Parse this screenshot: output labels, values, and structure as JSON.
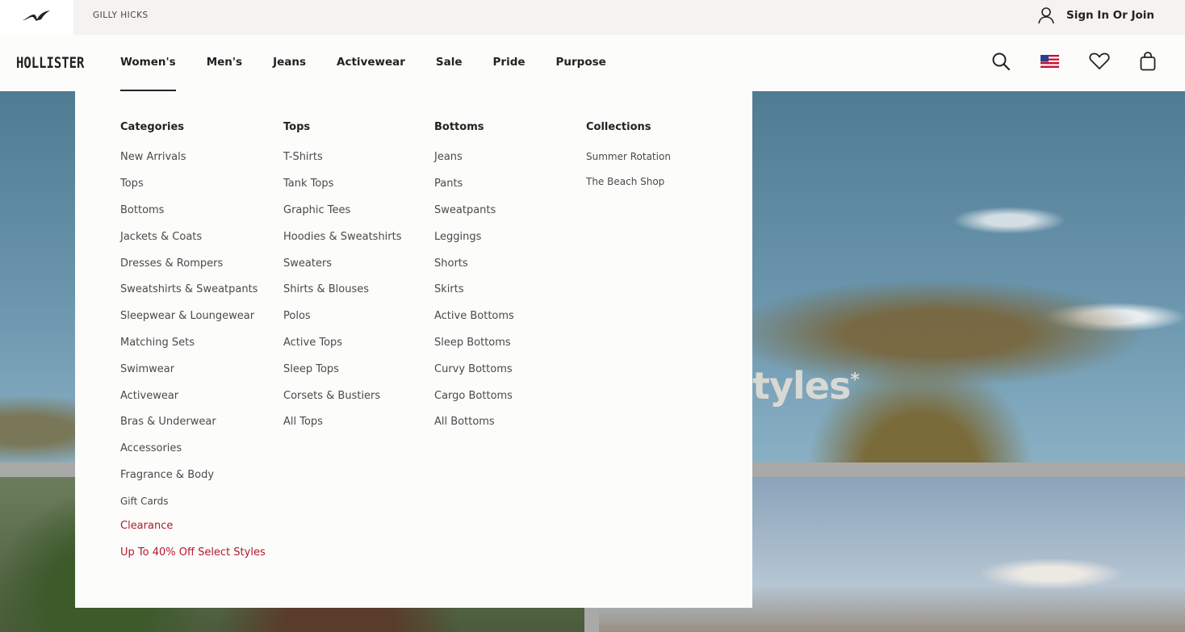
{
  "topbar": {
    "gilly_hicks": "GILLY HICKS",
    "sign_in": "Sign In Or Join"
  },
  "nav": {
    "logo": "HOLLISTER",
    "items": [
      "Women's",
      "Men's",
      "Jeans",
      "Activewear",
      "Sale",
      "Pride",
      "Purpose"
    ],
    "active": "Women's"
  },
  "hero": {
    "text": "tyles",
    "asterisk": "*"
  },
  "menu": {
    "categories": {
      "title": "Categories",
      "links": [
        "New Arrivals",
        "Tops",
        "Bottoms",
        "Jackets & Coats",
        "Dresses & Rompers",
        "Sweatshirts & Sweatpants",
        "Sleepwear & Loungewear",
        "Matching Sets",
        "Swimwear",
        "Activewear",
        "Bras & Underwear",
        "Accessories",
        "Fragrance & Body",
        "Gift Cards",
        "Clearance",
        "Up To 40% Off Select Styles"
      ]
    },
    "tops": {
      "title": "Tops",
      "links": [
        "T-Shirts",
        "Tank Tops",
        "Graphic Tees",
        "Hoodies & Sweatshirts",
        "Sweaters",
        "Shirts & Blouses",
        "Polos",
        "Active Tops",
        "Sleep Tops",
        "Corsets & Bustiers",
        "All Tops"
      ]
    },
    "bottoms": {
      "title": "Bottoms",
      "links": [
        "Jeans",
        "Pants",
        "Sweatpants",
        "Leggings",
        "Shorts",
        "Skirts",
        "Active Bottoms",
        "Sleep Bottoms",
        "Curvy Bottoms",
        "Cargo Bottoms",
        "All Bottoms"
      ]
    },
    "collections": {
      "title": "Collections",
      "links": [
        "Summer Rotation",
        "The Beach Shop"
      ]
    }
  },
  "icons": {
    "gull": "seagull-logo-icon",
    "account": "user-icon",
    "search": "search-icon",
    "flag": "us-flag-icon",
    "wishlist": "heart-icon",
    "bag": "shopping-bag-icon"
  },
  "colors": {
    "sale_red": "#b3192b",
    "text": "#222222",
    "panel": "#fcfcfb"
  }
}
